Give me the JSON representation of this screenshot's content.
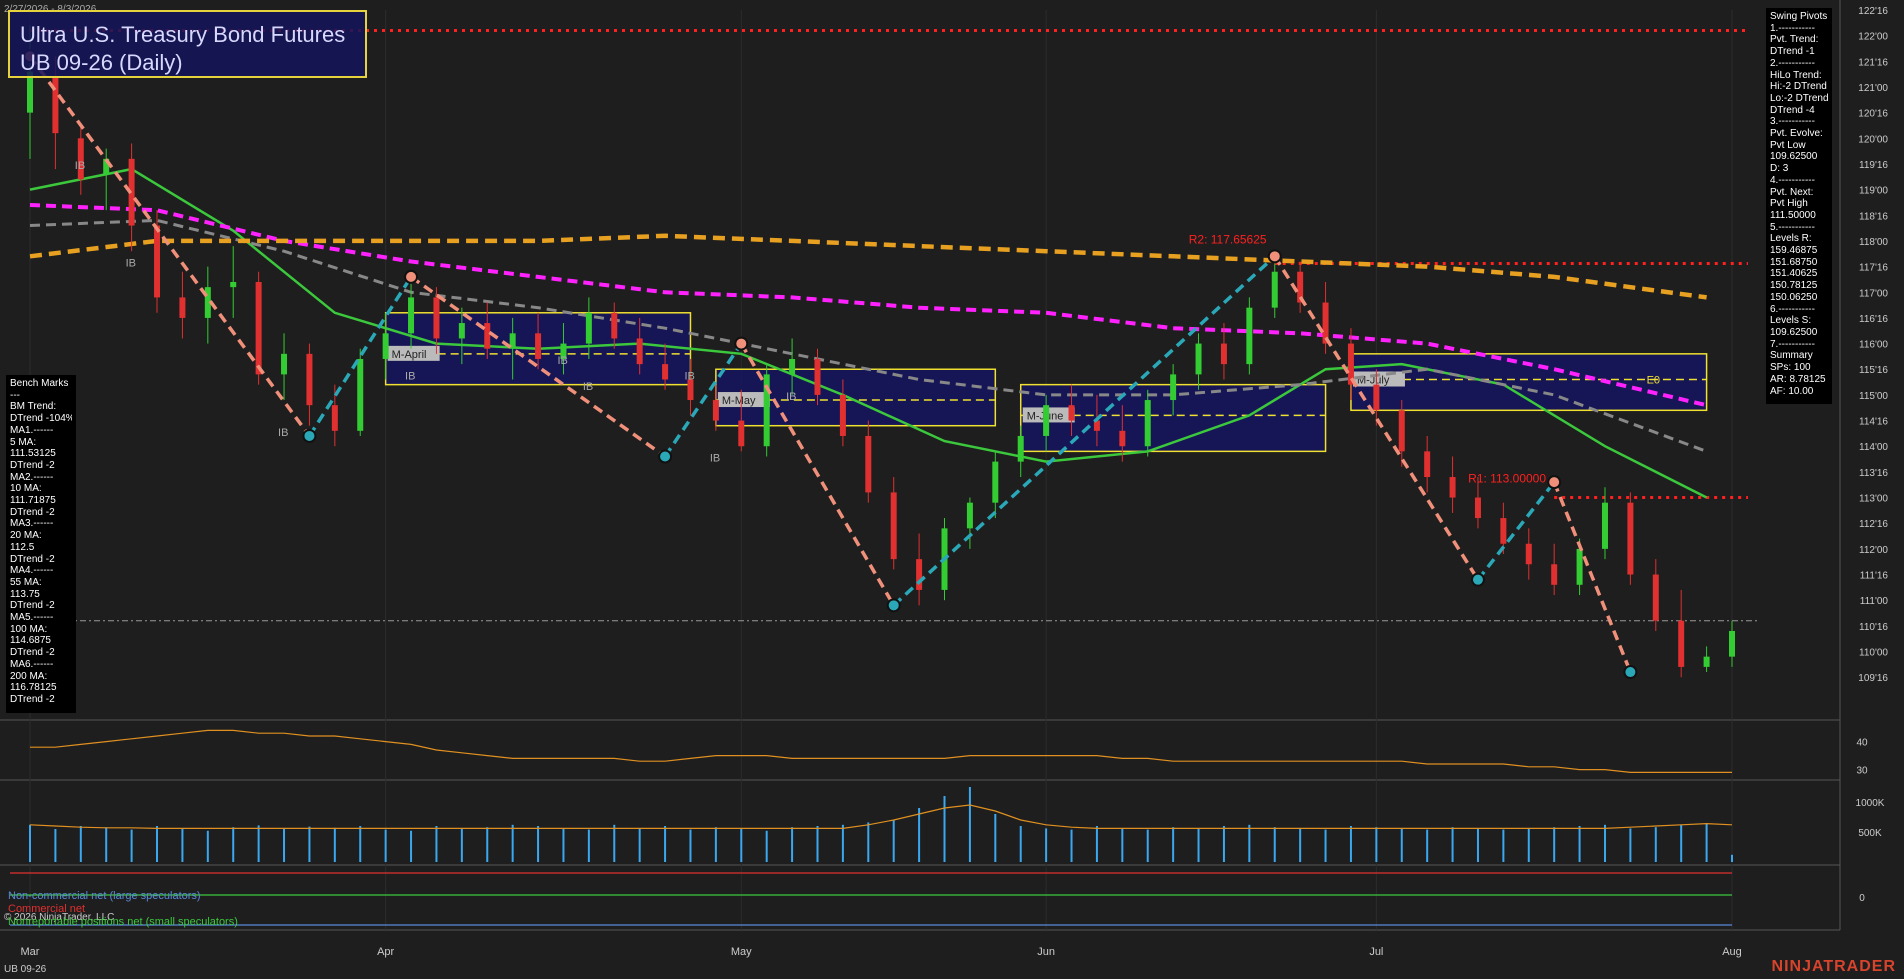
{
  "header": {
    "date_range": "2/27/2026 - 8/3/2026",
    "title": "Ultra U.S. Treasury Bond Futures",
    "subtitle": "UB 09-26 (Daily)"
  },
  "bench_marks": [
    "Bench Marks",
    "---",
    "BM Trend:",
    "DTrend -104%",
    "MA1.------",
    "5 MA:",
    "111.53125",
    "DTrend -2",
    "MA2.------",
    "10 MA:",
    "111.71875",
    "DTrend -2",
    "MA3.------",
    "20 MA:",
    "112.5",
    "DTrend -2",
    "MA4.------",
    "55 MA:",
    "113.75",
    "DTrend -2",
    "MA5.------",
    "100 MA:",
    "114.6875",
    "DTrend -2",
    "MA6.------",
    "200 MA:",
    "116.78125",
    "DTrend -2"
  ],
  "swing_pivots": [
    "Swing Pivots",
    "1.-----------",
    "Pvt. Trend:",
    "DTrend -1",
    "2.-----------",
    "HiLo Trend:",
    "Hi:-2 DTrend",
    "Lo:-2 DTrend",
    "DTrend -4",
    "3.-----------",
    "Pvt. Evolve:",
    "Pvt Low",
    "109.62500",
    "D: 3",
    "4.-----------",
    "Pvt. Next:",
    "Pvt High",
    "111.50000",
    "5.-----------",
    "Levels R:",
    "159.46875",
    "151.68750",
    "151.40625",
    "150.78125",
    "150.06250",
    "6.-----------",
    "Levels S:",
    "109.62500",
    "7.-----------",
    "Summary",
    "SPs: 100",
    "AR: 8.78125",
    "AF: 10.00"
  ],
  "cot_legend": {
    "noncommercial": "Non-commercial net (large speculators)",
    "commercial": "Commercial net",
    "nonreportable": "Nonreportable positions net (small speculators)"
  },
  "footer": {
    "copyright": "© 2026 NinjaTrader, LLC",
    "instrument": "UB 09-26",
    "brand": "NINJATRADER"
  },
  "colors": {
    "up_candle": "#33cc33",
    "down_candle": "#e03030",
    "ma_green": "#3cc83c",
    "ma_magenta": "#ff22ff",
    "ma_gray": "#888888",
    "ma_orange": "#e8a020",
    "resistance": "#ff2020",
    "swing_up": "#2aa8b8",
    "swing_down": "#f0907a",
    "zone_fill": "#141464",
    "zone_border": "#f0e030"
  },
  "chart_data": {
    "type": "candlestick",
    "price_axis": {
      "min": 109.25,
      "max": 122.5,
      "tick_labels": [
        "122'16",
        "122'00",
        "121'16",
        "121'00",
        "120'16",
        "120'00",
        "119'16",
        "119'00",
        "118'16",
        "118'00",
        "117'16",
        "117'00",
        "116'16",
        "116'00",
        "115'16",
        "115'00",
        "114'16",
        "114'00",
        "113'16",
        "113'00",
        "112'16",
        "112'00",
        "111'16",
        "111'00",
        "110'16",
        "110'00",
        "109'16"
      ],
      "tick_values": [
        122.5,
        122,
        121.5,
        121,
        120.5,
        120,
        119.5,
        119,
        118.5,
        118,
        117.5,
        117,
        116.5,
        116,
        115.5,
        115,
        114.5,
        114,
        113.5,
        113,
        112.5,
        112,
        111.5,
        111,
        110.5,
        110,
        109.5
      ]
    },
    "x_axis": {
      "labels": [
        "Mar",
        "Apr",
        "May",
        "Jun",
        "Jul",
        "Aug"
      ],
      "label_bar_index": [
        0,
        14,
        28,
        40,
        53,
        67
      ],
      "bar_count": 68
    },
    "bars": [
      {
        "o": 120.5,
        "h": 122.2,
        "l": 119.6,
        "c": 121.3
      },
      {
        "o": 121.2,
        "h": 121.6,
        "l": 119.4,
        "c": 120.1
      },
      {
        "o": 120.0,
        "h": 120.3,
        "l": 118.9,
        "c": 119.2
      },
      {
        "o": 119.3,
        "h": 119.8,
        "l": 118.6,
        "c": 119.6
      },
      {
        "o": 119.6,
        "h": 119.9,
        "l": 117.8,
        "c": 118.3
      },
      {
        "o": 118.3,
        "h": 118.6,
        "l": 116.6,
        "c": 116.9
      },
      {
        "o": 116.9,
        "h": 117.4,
        "l": 116.1,
        "c": 116.5
      },
      {
        "o": 116.5,
        "h": 117.5,
        "l": 116.0,
        "c": 117.1
      },
      {
        "o": 117.1,
        "h": 117.9,
        "l": 116.5,
        "c": 117.2
      },
      {
        "o": 117.2,
        "h": 117.4,
        "l": 115.2,
        "c": 115.4
      },
      {
        "o": 115.4,
        "h": 116.2,
        "l": 114.9,
        "c": 115.8
      },
      {
        "o": 115.8,
        "h": 116.0,
        "l": 114.4,
        "c": 114.8
      },
      {
        "o": 114.8,
        "h": 115.2,
        "l": 114.0,
        "c": 114.3
      },
      {
        "o": 114.3,
        "h": 115.9,
        "l": 114.2,
        "c": 115.7
      },
      {
        "o": 115.7,
        "h": 116.6,
        "l": 115.3,
        "c": 116.2
      },
      {
        "o": 116.2,
        "h": 117.3,
        "l": 115.9,
        "c": 116.9
      },
      {
        "o": 116.9,
        "h": 117.1,
        "l": 115.8,
        "c": 116.1
      },
      {
        "o": 116.1,
        "h": 116.7,
        "l": 115.6,
        "c": 116.4
      },
      {
        "o": 116.4,
        "h": 116.8,
        "l": 115.7,
        "c": 115.9
      },
      {
        "o": 115.9,
        "h": 116.5,
        "l": 115.3,
        "c": 116.2
      },
      {
        "o": 116.2,
        "h": 116.6,
        "l": 115.5,
        "c": 115.7
      },
      {
        "o": 115.7,
        "h": 116.4,
        "l": 115.4,
        "c": 116.0
      },
      {
        "o": 116.0,
        "h": 116.9,
        "l": 115.7,
        "c": 116.6
      },
      {
        "o": 116.6,
        "h": 116.8,
        "l": 115.9,
        "c": 116.1
      },
      {
        "o": 116.1,
        "h": 116.5,
        "l": 115.4,
        "c": 115.6
      },
      {
        "o": 115.6,
        "h": 116.0,
        "l": 115.1,
        "c": 115.3
      },
      {
        "o": 115.3,
        "h": 115.7,
        "l": 114.6,
        "c": 114.9
      },
      {
        "o": 114.9,
        "h": 115.2,
        "l": 114.3,
        "c": 114.5
      },
      {
        "o": 114.5,
        "h": 115.1,
        "l": 113.9,
        "c": 114.0
      },
      {
        "o": 114.0,
        "h": 115.6,
        "l": 113.8,
        "c": 115.4
      },
      {
        "o": 115.4,
        "h": 116.1,
        "l": 115.0,
        "c": 115.7
      },
      {
        "o": 115.7,
        "h": 115.9,
        "l": 114.8,
        "c": 115.0
      },
      {
        "o": 115.0,
        "h": 115.3,
        "l": 114.0,
        "c": 114.2
      },
      {
        "o": 114.2,
        "h": 114.5,
        "l": 112.9,
        "c": 113.1
      },
      {
        "o": 113.1,
        "h": 113.4,
        "l": 111.6,
        "c": 111.8
      },
      {
        "o": 111.8,
        "h": 112.3,
        "l": 110.9,
        "c": 111.2
      },
      {
        "o": 111.2,
        "h": 112.6,
        "l": 111.0,
        "c": 112.4
      },
      {
        "o": 112.4,
        "h": 113.0,
        "l": 112.0,
        "c": 112.9
      },
      {
        "o": 112.9,
        "h": 113.9,
        "l": 112.6,
        "c": 113.7
      },
      {
        "o": 113.7,
        "h": 114.4,
        "l": 113.4,
        "c": 114.2
      },
      {
        "o": 114.2,
        "h": 115.0,
        "l": 113.9,
        "c": 114.8
      },
      {
        "o": 114.8,
        "h": 115.2,
        "l": 114.2,
        "c": 114.5
      },
      {
        "o": 114.5,
        "h": 115.0,
        "l": 114.0,
        "c": 114.3
      },
      {
        "o": 114.3,
        "h": 114.8,
        "l": 113.7,
        "c": 114.0
      },
      {
        "o": 114.0,
        "h": 115.1,
        "l": 113.8,
        "c": 114.9
      },
      {
        "o": 114.9,
        "h": 115.6,
        "l": 114.6,
        "c": 115.4
      },
      {
        "o": 115.4,
        "h": 116.2,
        "l": 115.1,
        "c": 116.0
      },
      {
        "o": 116.0,
        "h": 116.4,
        "l": 115.3,
        "c": 115.6
      },
      {
        "o": 115.6,
        "h": 116.9,
        "l": 115.4,
        "c": 116.7
      },
      {
        "o": 116.7,
        "h": 117.7,
        "l": 116.5,
        "c": 117.4
      },
      {
        "o": 117.4,
        "h": 117.6,
        "l": 116.6,
        "c": 116.8
      },
      {
        "o": 116.8,
        "h": 117.2,
        "l": 115.8,
        "c": 116.0
      },
      {
        "o": 116.0,
        "h": 116.3,
        "l": 114.9,
        "c": 115.2
      },
      {
        "o": 115.2,
        "h": 115.5,
        "l": 114.4,
        "c": 114.7
      },
      {
        "o": 114.7,
        "h": 114.9,
        "l": 113.6,
        "c": 113.9
      },
      {
        "o": 113.9,
        "h": 114.2,
        "l": 113.1,
        "c": 113.4
      },
      {
        "o": 113.4,
        "h": 113.8,
        "l": 112.7,
        "c": 113.0
      },
      {
        "o": 113.0,
        "h": 113.4,
        "l": 112.4,
        "c": 112.6
      },
      {
        "o": 112.6,
        "h": 112.9,
        "l": 111.9,
        "c": 112.1
      },
      {
        "o": 112.1,
        "h": 112.4,
        "l": 111.4,
        "c": 111.7
      },
      {
        "o": 111.7,
        "h": 112.1,
        "l": 111.1,
        "c": 111.3
      },
      {
        "o": 111.3,
        "h": 112.2,
        "l": 111.1,
        "c": 112.0
      },
      {
        "o": 112.0,
        "h": 113.2,
        "l": 111.8,
        "c": 112.9
      },
      {
        "o": 112.9,
        "h": 113.1,
        "l": 111.3,
        "c": 111.5
      },
      {
        "o": 111.5,
        "h": 111.8,
        "l": 110.4,
        "c": 110.6
      },
      {
        "o": 110.6,
        "h": 111.2,
        "l": 109.5,
        "c": 109.7
      },
      {
        "o": 109.7,
        "h": 110.1,
        "l": 109.6,
        "c": 109.9
      },
      {
        "o": 109.9,
        "h": 110.6,
        "l": 109.7,
        "c": 110.4
      }
    ],
    "moving_averages": [
      {
        "name": "20 MA",
        "color": "#3cc83c",
        "points": [
          [
            0,
            119.0
          ],
          [
            4,
            119.4
          ],
          [
            8,
            118.2
          ],
          [
            12,
            116.6
          ],
          [
            16,
            116.0
          ],
          [
            20,
            115.9
          ],
          [
            24,
            116.0
          ],
          [
            28,
            115.8
          ],
          [
            32,
            115.0
          ],
          [
            36,
            114.1
          ],
          [
            40,
            113.7
          ],
          [
            44,
            113.9
          ],
          [
            48,
            114.6
          ],
          [
            51,
            115.5
          ],
          [
            54,
            115.6
          ],
          [
            58,
            115.2
          ],
          [
            62,
            114.0
          ],
          [
            66,
            113.0
          ]
        ]
      },
      {
        "name": "55 MA",
        "color": "#888888",
        "points": [
          [
            0,
            118.3
          ],
          [
            5,
            118.4
          ],
          [
            10,
            117.8
          ],
          [
            15,
            117.0
          ],
          [
            20,
            116.7
          ],
          [
            25,
            116.3
          ],
          [
            30,
            115.8
          ],
          [
            35,
            115.3
          ],
          [
            40,
            115.0
          ],
          [
            45,
            115.0
          ],
          [
            50,
            115.2
          ],
          [
            55,
            115.5
          ],
          [
            60,
            115.0
          ],
          [
            66,
            113.9
          ]
        ]
      },
      {
        "name": "100 MA",
        "color": "#ff22ff",
        "points": [
          [
            0,
            118.7
          ],
          [
            5,
            118.6
          ],
          [
            10,
            118.0
          ],
          [
            15,
            117.6
          ],
          [
            20,
            117.3
          ],
          [
            25,
            117.0
          ],
          [
            30,
            116.9
          ],
          [
            35,
            116.7
          ],
          [
            40,
            116.6
          ],
          [
            45,
            116.3
          ],
          [
            50,
            116.2
          ],
          [
            55,
            116.0
          ],
          [
            60,
            115.5
          ],
          [
            66,
            114.8
          ]
        ]
      },
      {
        "name": "200 MA",
        "color": "#e8a020",
        "points": [
          [
            0,
            117.7
          ],
          [
            5,
            118.0
          ],
          [
            10,
            118.0
          ],
          [
            15,
            118.0
          ],
          [
            20,
            118.0
          ],
          [
            25,
            118.1
          ],
          [
            30,
            118.0
          ],
          [
            35,
            117.9
          ],
          [
            40,
            117.8
          ],
          [
            45,
            117.7
          ],
          [
            50,
            117.6
          ],
          [
            55,
            117.5
          ],
          [
            60,
            117.3
          ],
          [
            66,
            116.9
          ]
        ]
      }
    ],
    "swing_points": [
      [
        0,
        121.6
      ],
      [
        11,
        114.2
      ],
      [
        15,
        117.3
      ],
      [
        25,
        113.8
      ],
      [
        28,
        116.0
      ],
      [
        34,
        110.9
      ],
      [
        49,
        117.7
      ],
      [
        57,
        111.4
      ],
      [
        60,
        113.3
      ],
      [
        63,
        109.6
      ]
    ],
    "pivot_annotations": [
      {
        "label": "R2: 117.65625",
        "bar": 49,
        "price": 117.65625
      },
      {
        "label": "R1: 113.00000",
        "bar": 60,
        "price": 113.0
      }
    ],
    "resistance_lines": [
      {
        "price": 122.1,
        "from": 0,
        "to": 67
      },
      {
        "price": 117.56,
        "from": 49,
        "to": 67
      },
      {
        "price": 113.0,
        "from": 60,
        "to": 67
      }
    ],
    "reference_line": 110.6,
    "zones": [
      {
        "label": "M-April",
        "from": 14,
        "to": 26,
        "top": 116.6,
        "bottom": 115.2,
        "mid": 115.8
      },
      {
        "label": "M-May",
        "from": 27,
        "to": 38,
        "top": 115.5,
        "bottom": 114.4,
        "mid": 114.9
      },
      {
        "label": "M-June",
        "from": 39,
        "to": 51,
        "top": 115.2,
        "bottom": 113.9,
        "mid": 114.6
      },
      {
        "label": "M-July",
        "from": 52,
        "to": 66,
        "top": 115.8,
        "bottom": 114.7,
        "mid": 115.3
      }
    ],
    "zone_extra_label": "E0",
    "ib_labels": [
      [
        2,
        119.4
      ],
      [
        4,
        117.5
      ],
      [
        10,
        114.2
      ],
      [
        15,
        115.3
      ],
      [
        21,
        115.6
      ],
      [
        22,
        115.1
      ],
      [
        26,
        115.3
      ],
      [
        27,
        113.7
      ],
      [
        30,
        114.9
      ]
    ],
    "oscillator": {
      "tick_labels": [
        "40",
        "30"
      ],
      "tick_values": [
        40,
        30
      ],
      "min": 27,
      "max": 47,
      "values": [
        38,
        38,
        39,
        40,
        41,
        42,
        43,
        44,
        44,
        43,
        43,
        42,
        42,
        41,
        40,
        39,
        37,
        36,
        35,
        34,
        34,
        34,
        34,
        34,
        33,
        33,
        34,
        35,
        35,
        35,
        34,
        34,
        34,
        34,
        34,
        34,
        34,
        35,
        35,
        35,
        35,
        35,
        35,
        34,
        34,
        33,
        33,
        33,
        33,
        33,
        33,
        33,
        33,
        33,
        33,
        32,
        32,
        32,
        32,
        31,
        31,
        30,
        30,
        29,
        29,
        29,
        29,
        29
      ]
    },
    "volume": {
      "tick_labels": [
        "1000K",
        "500K"
      ],
      "tick_values": [
        1000,
        500
      ],
      "min": 0,
      "max": 1300,
      "values": [
        620,
        550,
        600,
        580,
        540,
        600,
        560,
        520,
        580,
        610,
        560,
        590,
        570,
        600,
        540,
        520,
        600,
        560,
        580,
        620,
        600,
        560,
        540,
        620,
        560,
        600,
        540,
        580,
        560,
        520,
        580,
        600,
        620,
        660,
        700,
        900,
        1100,
        1250,
        800,
        600,
        560,
        540,
        600,
        560,
        540,
        580,
        560,
        600,
        620,
        580,
        560,
        540,
        600,
        580,
        560,
        540,
        580,
        560,
        540,
        560,
        580,
        600,
        620,
        560,
        580,
        620,
        640,
        120
      ],
      "avg_line": [
        620,
        600,
        580,
        570,
        570,
        560,
        560,
        560,
        560,
        560,
        560,
        560,
        560,
        560,
        560,
        560,
        560,
        560,
        560,
        560,
        560,
        560,
        560,
        560,
        560,
        560,
        560,
        560,
        560,
        560,
        560,
        560,
        560,
        620,
        700,
        800,
        900,
        950,
        850,
        700,
        620,
        580,
        560,
        560,
        560,
        560,
        560,
        560,
        560,
        560,
        560,
        560,
        560,
        560,
        560,
        560,
        560,
        560,
        560,
        560,
        560,
        560,
        560,
        580,
        600,
        620,
        640,
        620
      ]
    },
    "cot": {
      "tick_labels": [
        "0"
      ],
      "tick_values": [
        0
      ],
      "min": -1,
      "max": 1,
      "series": [
        {
          "name": "Non-commercial net (large speculators)",
          "color": "#5a8adc",
          "level": -0.7
        },
        {
          "name": "Commercial net",
          "color": "#e03030",
          "level": 0.6
        },
        {
          "name": "Nonreportable positions net (small speculators)",
          "color": "#3cc83c",
          "level": 0.05
        }
      ]
    }
  }
}
